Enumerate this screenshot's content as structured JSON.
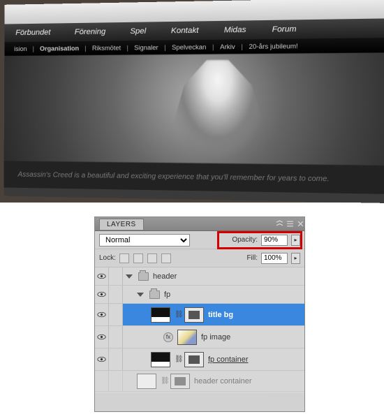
{
  "preview": {
    "nav": [
      "Förbundet",
      "Förening",
      "Spel",
      "Kontakt",
      "Midas",
      "Forum"
    ],
    "subnav": [
      "ision",
      "Organisation",
      "Riksmötet",
      "Signaler",
      "Spelveckan",
      "Arkiv",
      "20-års jubileum!"
    ],
    "caption": "Assassin's Creed is a beautiful and exciting experience that you'll remember for years to come."
  },
  "panel": {
    "tab": "LAYERS",
    "blend_mode": "Normal",
    "opacity_label": "Opacity:",
    "opacity_value": "90%",
    "lock_label": "Lock:",
    "fill_label": "Fill:",
    "fill_value": "100%",
    "layers": [
      {
        "name": "header",
        "type": "group",
        "depth": 0
      },
      {
        "name": "fp",
        "type": "group",
        "depth": 1
      },
      {
        "name": "title bg",
        "type": "layer",
        "selected": true,
        "depth": 2
      },
      {
        "name": "fp image",
        "type": "layer",
        "fx": true,
        "depth": 2
      },
      {
        "name": "fp container",
        "type": "layer",
        "underline": true,
        "depth": 2
      },
      {
        "name": "header container",
        "type": "layer",
        "depth": 1
      }
    ]
  }
}
